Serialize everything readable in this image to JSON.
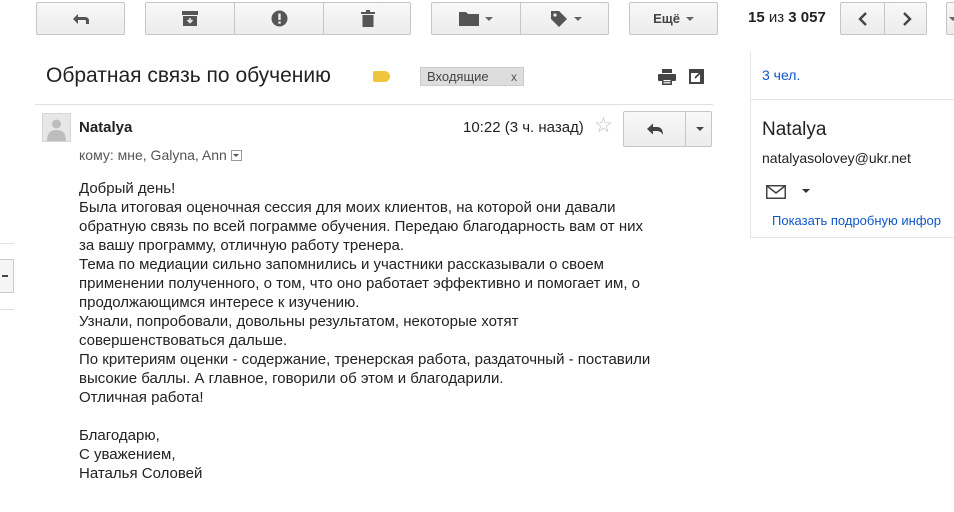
{
  "toolbar": {
    "back_icon": "back-arrow-icon",
    "archive_icon": "archive-icon",
    "spam_icon": "report-spam-icon",
    "delete_icon": "trash-icon",
    "move_icon": "folder-icon",
    "labels_icon": "tag-icon",
    "more_label": "Ещё",
    "counter_current": "15",
    "counter_sep": " из ",
    "counter_total": "3 057"
  },
  "thread": {
    "subject": "Обратная связь по обучению",
    "label_chip": "Входящие",
    "label_chip_remove": "x",
    "importance_color": "#f0c53b"
  },
  "message": {
    "sender": "Natalya",
    "recipients": "кому: мне, Galyna, Ann",
    "time": "10:22 (3 ч. назад)",
    "star": "☆",
    "body_lines": [
      "Добрый день!",
      "Была итоговая оценочная сессия для моих клиентов, на которой они давали",
      "обратную связь по всей пограмме обучения. Передаю благодарность вам  от них",
      "за вашу программу, отличную работу тренера.",
      "Тема по медиации сильно запомнились и участники рассказывали о своем",
      "применении полученного, о том, что оно работает эффективно и помогает им, о",
      "продолжающимся интересе к изучению.",
      "Узнали, попробовали, довольны результатом, некоторые хотят",
      "совершенствоваться дальше.",
      "По критериям оценки - содержание, тренерская работа, раздаточный - поставили",
      "высокие баллы. А главное, говорили об этом и благодарили.",
      "Отличная работа!"
    ],
    "signature_lines": [
      "Благодарю,",
      "С уважением,",
      "Наталья Соловей"
    ]
  },
  "sidebar": {
    "people_count": "3 чел.",
    "contact_name": "Natalya",
    "contact_email": "natalyasolovey@ukr.net",
    "details_link": "Показать подробную инфор"
  }
}
